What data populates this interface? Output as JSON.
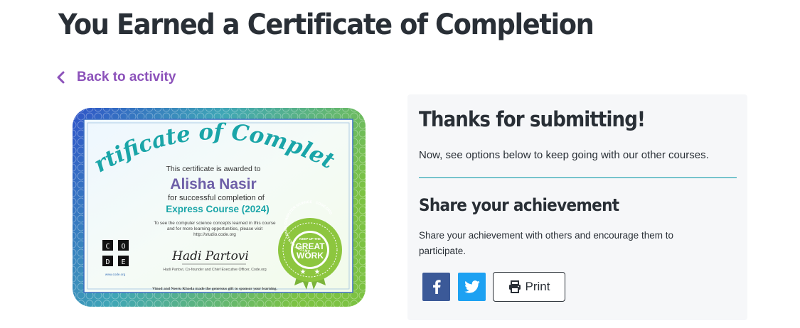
{
  "page": {
    "title": "You Earned a Certificate of Completion",
    "back_link": "Back to activity"
  },
  "certificate": {
    "heading": "Certificate of Completion",
    "awarded_line": "This certificate is awarded to",
    "recipient": "Alisha Nasir",
    "completion_line": "for successful completion of",
    "course": "Express Course (2024)",
    "note_line1": "To see the computer science concepts learned in this course",
    "note_line2": "and for more learning opportunities, please visit",
    "note_line3": "http://studio.code.org",
    "logo_letters": [
      "C",
      "O",
      "D",
      "E"
    ],
    "logo_caption": "www.code.org",
    "signature": "Hadi Partovi",
    "signer_title": "Hadi Partovi, Co-founder and Chief Executive Officer, Code.org",
    "sponsor_line": "Vinod and Neeru Khosla made the generous gift to sponsor your learning.",
    "badge_line1": "GREAT",
    "badge_line2": "WORK",
    "badge_ring_text": "ANYONE CAN LEARN COMPUTER SCIENCE · CODE.ORG",
    "badge_top_text": "KEEP UP THE"
  },
  "panel": {
    "heading": "Thanks for submitting!",
    "text": "Now, see options below to keep going with our other courses.",
    "share_heading": "Share your achievement",
    "share_text": "Share your achievement with others and encourage them to participate.",
    "print_label": "Print"
  },
  "colors": {
    "accent_purple": "#8c52ba",
    "teal": "#1aa5a8",
    "facebook": "#3b5998",
    "twitter": "#1da1f2",
    "badge_green": "#8dc63f"
  },
  "icons": {
    "back": "chevron-left-icon",
    "facebook": "facebook-icon",
    "twitter": "twitter-icon",
    "print": "printer-icon"
  }
}
